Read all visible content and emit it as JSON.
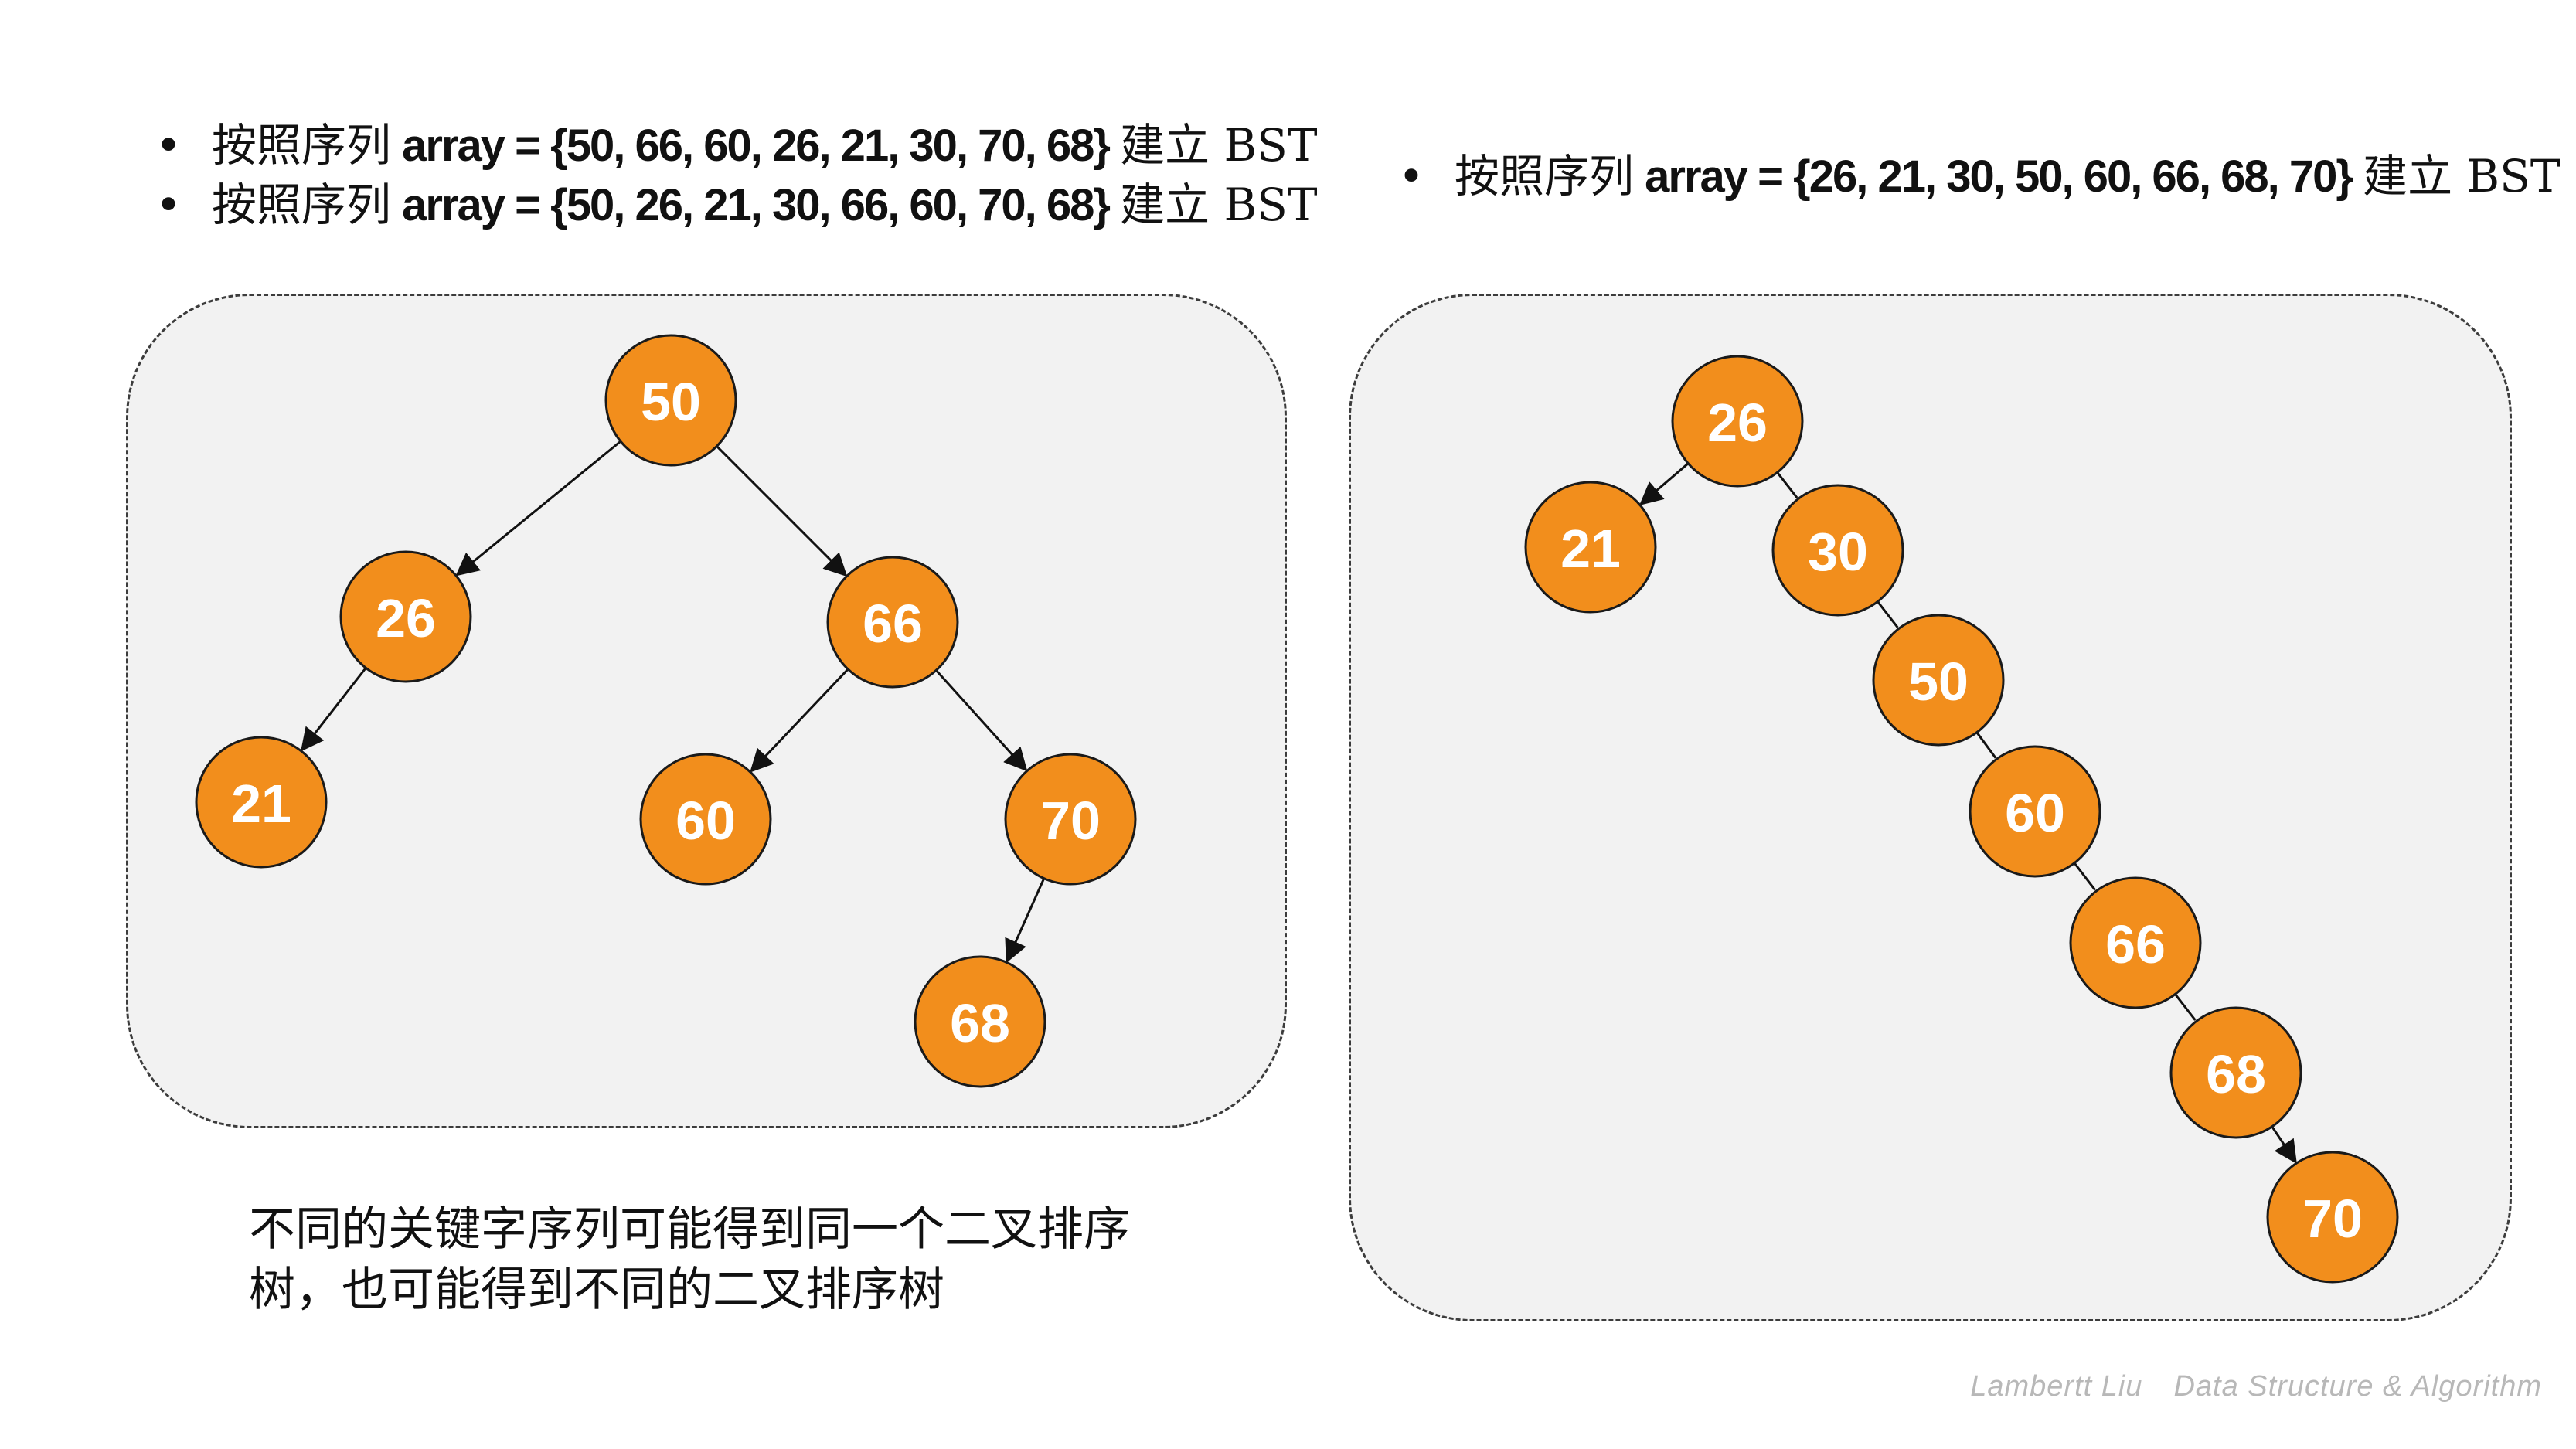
{
  "bullets_left": [
    {
      "prefix": "按照序列",
      "code": " array = {50, 66, 60, 26, 21, 30, 70, 68} ",
      "suffix": "建立 BST"
    },
    {
      "prefix": "按照序列",
      "code": " array = {50, 26, 21, 30, 66, 60, 70, 68} ",
      "suffix": "建立 BST"
    }
  ],
  "bullets_right": [
    {
      "prefix": "按照序列",
      "code": " array = {26, 21, 30, 50, 60, 66, 68, 70} ",
      "suffix": "建立 BST"
    }
  ],
  "bullet_glyph": "•",
  "caption_lines": [
    "不同的关键字序列可能得到同一个二叉排序",
    "树，也可能得到不同的二叉排序树"
  ],
  "trees": [
    {
      "panel": "left",
      "nodes": [
        "50",
        "26",
        "66",
        "21",
        "60",
        "70",
        "68"
      ],
      "edges": [
        [
          "50",
          "26"
        ],
        [
          "50",
          "66"
        ],
        [
          "26",
          "21"
        ],
        [
          "66",
          "60"
        ],
        [
          "66",
          "70"
        ],
        [
          "70",
          "68"
        ]
      ]
    },
    {
      "panel": "right",
      "nodes": [
        "26",
        "21",
        "30",
        "50",
        "60",
        "66",
        "68",
        "70"
      ],
      "edges": [
        [
          "26",
          "21"
        ],
        [
          "26",
          "30"
        ],
        [
          "30",
          "50"
        ],
        [
          "50",
          "60"
        ],
        [
          "60",
          "66"
        ],
        [
          "66",
          "68"
        ],
        [
          "68",
          "70"
        ]
      ]
    }
  ],
  "colors": {
    "node_fill": "#f28e1c",
    "node_stroke": "#1a1a1a",
    "node_text": "#ffffff",
    "panel_fill": "#f2f2f2",
    "panel_border": "#3c3c3c",
    "watermark": "#b8b8b8"
  },
  "watermark": {
    "author": "Lambertt Liu",
    "topic": "Data Structure & Algorithm"
  }
}
